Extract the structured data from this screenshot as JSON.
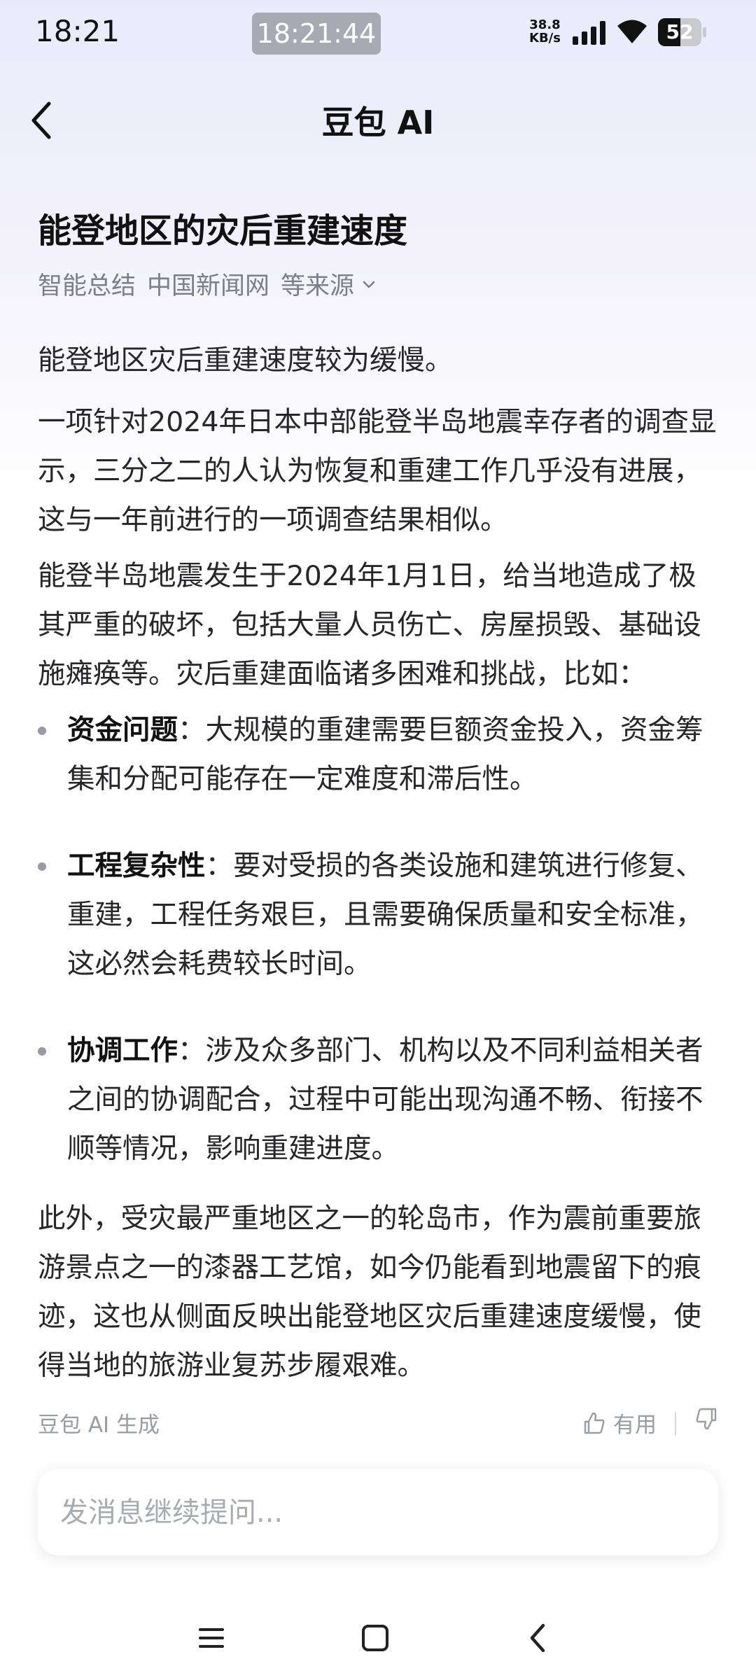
{
  "status_bar": {
    "time": "18:21",
    "clock_badge": "18:21:44",
    "net_speed_value": "38.8",
    "net_speed_unit": "KB/s",
    "battery_level": "52",
    "battery_fraction": 0.52
  },
  "header": {
    "title": "豆包 AI"
  },
  "article": {
    "title": "能登地区的灾后重建速度",
    "sources": {
      "part1": "智能总结",
      "part2": "中国新闻网",
      "part3": "等来源"
    },
    "paragraphs": [
      "能登地区灾后重建速度较为缓慢。",
      "一项针对2024年日本中部能登半岛地震幸存者的调查显示，三分之二的人认为恢复和重建工作几乎没有进展，这与一年前进行的一项调查结果相似。",
      "能登半岛地震发生于2024年1月1日，给当地造成了极其严重的破坏，包括大量人员伤亡、房屋损毁、基础设施瘫痪等。灾后重建面临诸多困难和挑战，比如："
    ],
    "bullets": [
      {
        "term": "资金问题",
        "text": "：大规模的重建需要巨额资金投入，资金筹集和分配可能存在一定难度和滞后性。"
      },
      {
        "term": "工程复杂性",
        "text": "：要对受损的各类设施和建筑进行修复、重建，工程任务艰巨，且需要确保质量和安全标准，这必然会耗费较长时间。"
      },
      {
        "term": "协调工作",
        "text": "：涉及众多部门、机构以及不同利益相关者之间的协调配合，过程中可能出现沟通不畅、衔接不顺等情况，影响重建进度。"
      }
    ],
    "closing": "此外，受灾最严重地区之一的轮岛市，作为震前重要旅游景点之一的漆器工艺馆，如今仍能看到地震留下的痕迹，这也从侧面反映出能登地区灾后重建速度缓慢，使得当地的旅游业复苏步履艰难。"
  },
  "footer": {
    "generated_by": "豆包 AI 生成",
    "useful_label": "有用"
  },
  "input": {
    "placeholder": "发消息继续提问..."
  }
}
